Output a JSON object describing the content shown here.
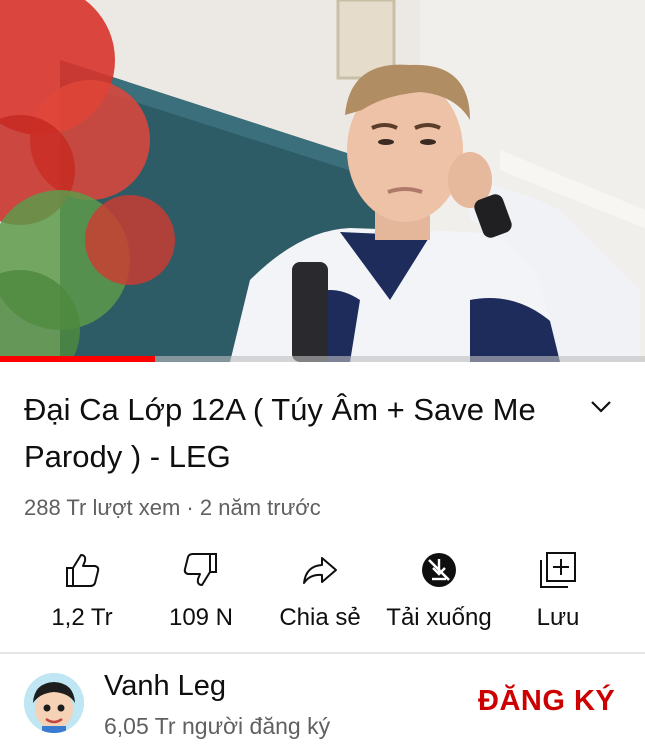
{
  "video": {
    "progress_fraction": 0.24
  },
  "title": "Đại Ca Lớp 12A ( Túy Âm + Save Me Parody ) - LEG",
  "meta": {
    "views": "288 Tr lượt xem",
    "separator": " · ",
    "age": "2 năm trước"
  },
  "actions": {
    "like": {
      "label": "1,2 Tr",
      "icon": "thumbs-up-icon"
    },
    "dislike": {
      "label": "109 N",
      "icon": "thumbs-down-icon"
    },
    "share": {
      "label": "Chia sẻ",
      "icon": "share-arrow-icon"
    },
    "download": {
      "label": "Tải xuống",
      "icon": "download-disabled-icon"
    },
    "save": {
      "label": "Lưu",
      "icon": "add-to-playlist-icon"
    }
  },
  "channel": {
    "name": "Vanh Leg",
    "subscribers": "6,05 Tr người đăng ký",
    "subscribe_label": "ĐĂNG KÝ"
  },
  "colors": {
    "accent_red": "#cc0000",
    "progress_red": "#ff0000",
    "secondary_text": "#606060"
  }
}
